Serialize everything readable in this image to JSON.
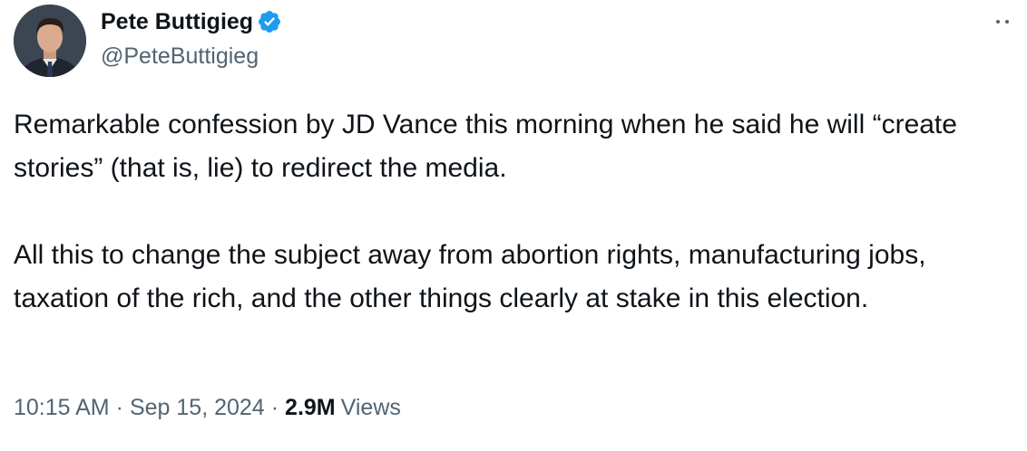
{
  "author": {
    "display_name": "Pete Buttigieg",
    "handle": "@PeteButtigieg",
    "verified_icon": "verified-badge-icon",
    "accent_color": "#1d9bf0"
  },
  "tweet": {
    "paragraphs": [
      "Remarkable confession by JD Vance this morning when he said he will “create stories” (that is, lie) to redirect the media.",
      "All this to change the subject away from abortion rights, manufacturing jobs, taxation of the rich, and the other things clearly at stake in this election."
    ]
  },
  "meta": {
    "time": "10:15 AM",
    "separator": "·",
    "date": "Sep 15, 2024",
    "views_count": "2.9M",
    "views_label": "Views"
  },
  "colors": {
    "text_primary": "#0f1419",
    "text_secondary": "#536471"
  }
}
